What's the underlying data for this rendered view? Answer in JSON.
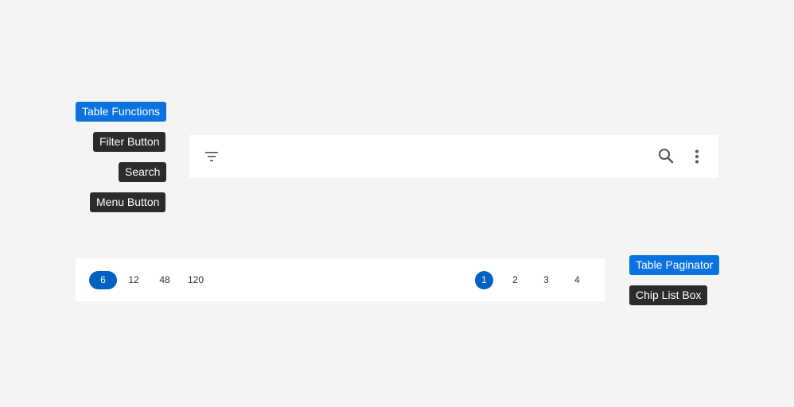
{
  "annotations": {
    "table_functions": "Table Functions",
    "filter_button": "Filter Button",
    "search": "Search",
    "menu_button": "Menu Button",
    "table_paginator": "Table Paginator",
    "chip_list_box": "Chip List Box"
  },
  "toolbar": {
    "icons": [
      "filter-icon",
      "search-icon",
      "more-vert-icon"
    ]
  },
  "paginator": {
    "page_size_chips": [
      "6",
      "12",
      "48",
      "120"
    ],
    "selected_page_size": "6",
    "pages": [
      "1",
      "2",
      "3",
      "4"
    ],
    "current_page": "1"
  },
  "colors": {
    "background": "#f4f4f4",
    "annotation_blue": "#0a73e0",
    "annotation_dark": "#2b2b2b",
    "selected": "#0061c2",
    "icon": "#555555"
  }
}
